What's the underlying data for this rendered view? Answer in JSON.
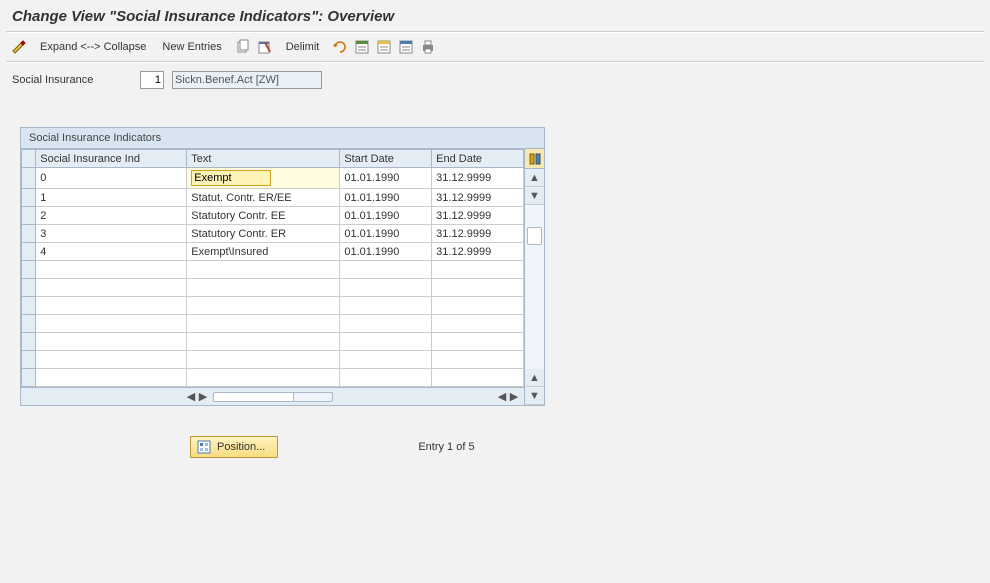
{
  "title": "Change View \"Social Insurance Indicators\": Overview",
  "toolbar": {
    "expand_collapse": "Expand <--> Collapse",
    "new_entries": "New Entries",
    "delimit": "Delimit"
  },
  "header": {
    "label": "Social Insurance",
    "code": "1",
    "description": "Sickn.Benef.Act [ZW]"
  },
  "table": {
    "title": "Social Insurance Indicators",
    "columns": {
      "ind": "Social Insurance Ind",
      "text": "Text",
      "start": "Start Date",
      "end": "End Date"
    },
    "rows": [
      {
        "ind": "0",
        "text": "Exempt",
        "start": "01.01.1990",
        "end": "31.12.9999",
        "editing": true
      },
      {
        "ind": "1",
        "text": "Statut. Contr. ER/EE",
        "start": "01.01.1990",
        "end": "31.12.9999"
      },
      {
        "ind": "2",
        "text": "Statutory Contr. EE",
        "start": "01.01.1990",
        "end": "31.12.9999"
      },
      {
        "ind": "3",
        "text": "Statutory Contr. ER",
        "start": "01.01.1990",
        "end": "31.12.9999"
      },
      {
        "ind": "4",
        "text": "Exempt\\Insured",
        "start": "01.01.1990",
        "end": "31.12.9999"
      }
    ],
    "empty_rows": 7
  },
  "footer": {
    "position_label": "Position...",
    "entry_text": "Entry 1 of 5"
  },
  "colors": {
    "panel_bg": "#d8e4f0",
    "header_cell": "#e4ecf4",
    "highlight": "#fff4b8"
  }
}
